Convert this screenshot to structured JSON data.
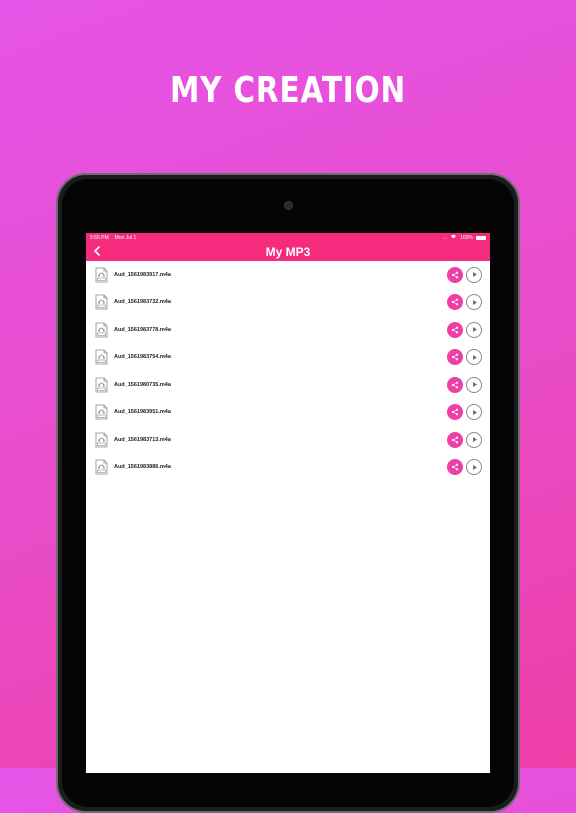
{
  "promo": {
    "title": "MY CREATION"
  },
  "status_bar": {
    "time": "5:55 PM",
    "date": "Mon Jul 1",
    "dots": "...",
    "battery": "100%"
  },
  "nav": {
    "title": "My MP3"
  },
  "files": [
    {
      "name": "Aud_1561983917.m4a"
    },
    {
      "name": "Aud_1561983732.m4a"
    },
    {
      "name": "Aud_1561983778.m4a"
    },
    {
      "name": "Aud_1561983754.m4a"
    },
    {
      "name": "Aud_1561980735.m4a"
    },
    {
      "name": "Aud_1561983951.m4a"
    },
    {
      "name": "Aud_1561983713.m4a"
    },
    {
      "name": "Aud_1561983886.m4a"
    }
  ],
  "icons": {
    "back": "chevron-left-icon",
    "file": "audio-file-icon",
    "share": "share-icon",
    "play": "play-icon",
    "wifi": "wifi-icon",
    "battery": "battery-icon"
  },
  "colors": {
    "accent": "#f52b7d",
    "share_button": "#ee3fa6",
    "background_top": "#e654e8",
    "background_bottom": "#ee3fa6"
  }
}
